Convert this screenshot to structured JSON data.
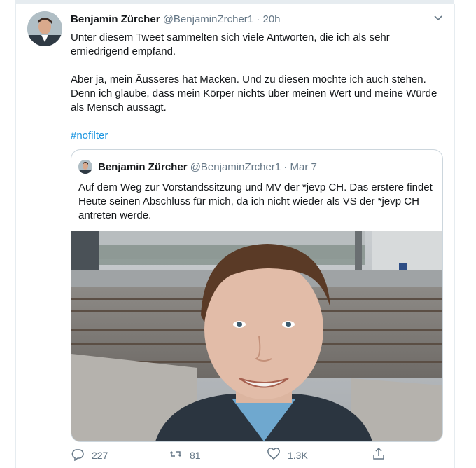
{
  "tweet": {
    "author_name": "Benjamin Zürcher",
    "handle": "@BenjaminZrcher1",
    "separator": "·",
    "time": "20h",
    "paragraphs": [
      "Unter diesem Tweet sammelten sich viele Antworten, die ich als sehr erniedrigend empfand.",
      "Aber ja, mein Äusseres hat Macken. Und zu diesen möchte ich auch stehen. Denn ich glaube, dass mein Körper nichts über meinen Wert und meine Würde als Mensch aussagt."
    ],
    "hashtag": "#nofilter"
  },
  "quoted": {
    "author_name": "Benjamin Zürcher",
    "handle": "@BenjaminZrcher1",
    "separator": "·",
    "date": "Mar 7",
    "text": "Auf dem Weg zur Vorstandssitzung und MV der *jevp CH. Das erstere findet Heute seinen Abschluss für mich, da ich nicht wieder als VS der *jevp CH antreten werde."
  },
  "actions": {
    "replies": "227",
    "retweets": "81",
    "likes": "1.3K"
  },
  "icons": {
    "caret": "chevron-down-icon",
    "reply": "reply-icon",
    "retweet": "retweet-icon",
    "like": "heart-icon",
    "share": "share-icon"
  },
  "colors": {
    "link": "#1b95e0",
    "muted": "#657786",
    "border": "#ccd6dd"
  }
}
